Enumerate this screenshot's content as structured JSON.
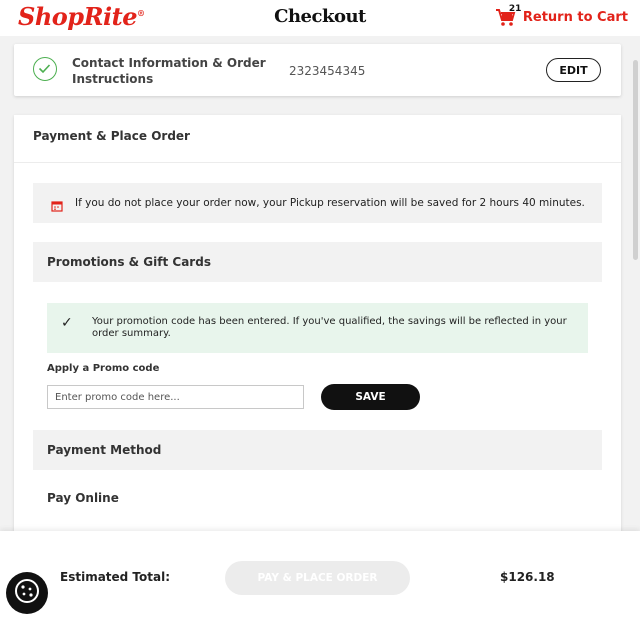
{
  "header": {
    "logo": "ShopRite",
    "title": "Checkout",
    "cart_count": "21",
    "return_label": "Return to Cart"
  },
  "contact": {
    "title": "Contact Information & Order Instructions",
    "phone": "2323454345",
    "edit_label": "EDIT"
  },
  "payment_section": {
    "title": "Payment & Place Order",
    "reservation_notice": "If you do not place your order now, your Pickup reservation will be saved for 2 hours 40 minutes.",
    "promotions_title": "Promotions & Gift Cards",
    "promo_success": "Your promotion code has been entered. If you've qualified, the savings will be reflected in your order summary.",
    "promo_label": "Apply a Promo code",
    "promo_placeholder": "Enter promo code here...",
    "promo_value": "",
    "save_label": "SAVE",
    "payment_method_title": "Payment Method",
    "pay_online_label": "Pay Online"
  },
  "footer": {
    "estimated_label": "Estimated Total:",
    "place_order_label": "PAY & PLACE ORDER",
    "total": "$126.18"
  },
  "colors": {
    "brand_red": "#e2231a",
    "success_green": "#4caf50",
    "success_bg": "#e8f5ec"
  },
  "icons": [
    "cart-icon",
    "check-circle-icon",
    "calendar-icon",
    "checkmark-icon",
    "cookie-icon"
  ]
}
